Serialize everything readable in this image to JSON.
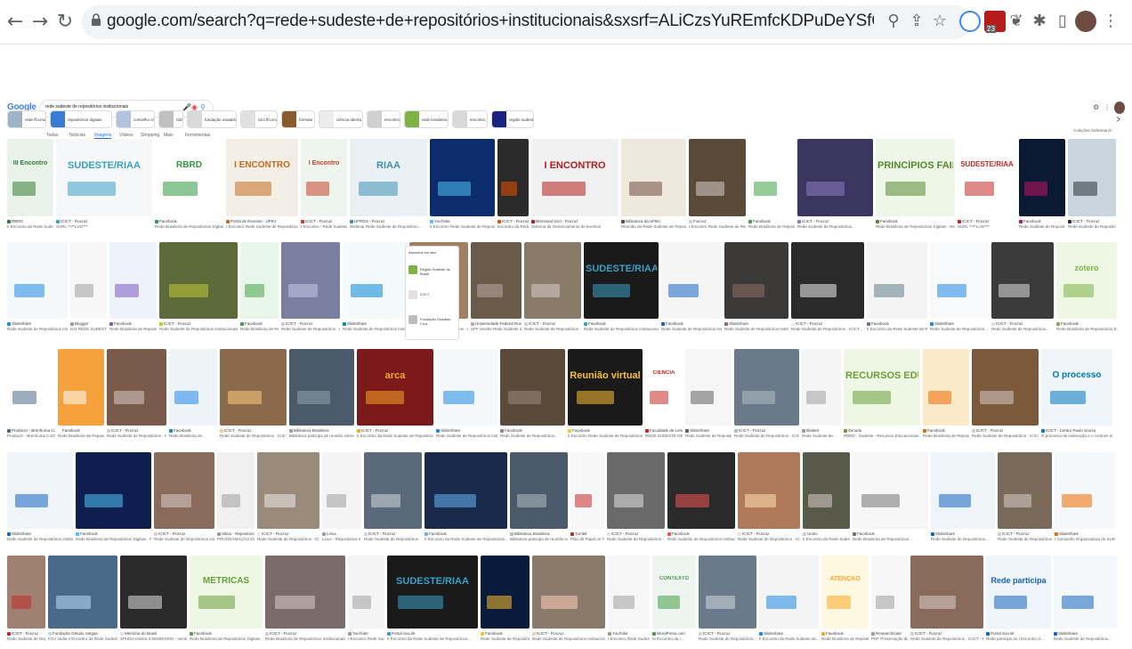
{
  "browser": {
    "url": "google.com/search?q=rede+sudeste+de+repositórios+institucionais&sxsrf=ALiCzsYuREmfcKDPuDeYSfCMs3Wp_0_ZYA:1672071993020&source=lnms&tbm=isch&sa=X...",
    "badge_count": "23",
    "nav_icons": [
      "back-arrow-icon",
      "forward-arrow-icon",
      "reload-icon"
    ]
  },
  "google": {
    "logo": "Google",
    "query": "rede sudeste de repositórios institucionais",
    "tabs": [
      "Todas",
      "Notícias",
      "Imagens",
      "Vídeos",
      "Shopping",
      "Mais",
      "Ferramentas"
    ],
    "right_links": "Coleções  SafeSearch"
  },
  "chips": [
    {
      "label": "rede ffccmus",
      "color": "#9fb3c8"
    },
    {
      "label": "repositórios digitais",
      "color": "#3a7bd5"
    },
    {
      "label": "conselho ciwt",
      "color": "#b0c4de"
    },
    {
      "label": "rbbt",
      "color": "#c0c0c0"
    },
    {
      "label": "fundação oswaldo",
      "color": "#d9d9d9"
    },
    {
      "label": "icict ffccmus",
      "color": "#e0e0e0"
    },
    {
      "label": "formato",
      "color": "#8b5a2b"
    },
    {
      "label": "ciência aberta",
      "color": "#ececec"
    },
    {
      "label": "encontro",
      "color": "#d0d0d0"
    },
    {
      "label": "rede brasileira",
      "color": "#7cb342"
    },
    {
      "label": "encontro",
      "color": "#d8d8d8"
    },
    {
      "label": "região sudeste",
      "color": "#1a237e"
    }
  ],
  "side_panel": {
    "title": "Assuntos em alta",
    "items": [
      "Região Sudeste do Brasil",
      "ICICT",
      "Fundação Oswaldo Cruz"
    ]
  },
  "rows": [
    [
      {
        "bg": "#eaf3ea",
        "accent": "#2e7d32",
        "text": "III Encontro",
        "src": "RBRD",
        "caption": "II Encontro da Rede Sudeste de R..."
      },
      {
        "bg": "#f5f7f9",
        "accent": "#3aa0c8",
        "text": "SUDESTE/RIAA",
        "src": "ICICT - Fiocruz",
        "caption": "SURL **7*LUG***"
      },
      {
        "bg": "#ffffff",
        "accent": "#2e9b3e",
        "text": "RBRD",
        "src": "Facebook",
        "caption": "Rede Brasileira de Repositórios Digitais - Fac..."
      },
      {
        "bg": "#f4efe6",
        "accent": "#c66a1e",
        "text": "I ENCONTRO",
        "src": "Portal de Eventos - UFRJ",
        "caption": "I Encontro Rede Sudeste de Repositórios..."
      },
      {
        "bg": "#eef4ee",
        "accent": "#c8402a",
        "text": "I Encontro",
        "src": "ICICT - Fiocruz",
        "caption": "I Encontro - Rede Sudeste de..."
      },
      {
        "bg": "#e9f1f4",
        "accent": "#3f8fb0",
        "text": "RIAA",
        "src": "UFRGS - Fiocruz",
        "caption": "Webinar Rede Sudeste de Repositório..."
      },
      {
        "bg": "#0d2c6c",
        "accent": "#4fc3f7",
        "text": "",
        "src": "YouTube",
        "caption": "II Encontro Rede Sudeste de Repositó..."
      },
      {
        "bg": "#2b2b2b",
        "accent": "#e65100",
        "text": "",
        "src": "ICICT - Fiocruz",
        "caption": "Encontro da Rede Sude..."
      },
      {
        "bg": "#f1f1f1",
        "accent": "#b71c1c",
        "text": "I ENCONTRO",
        "src": "Brennand Icict - Fiocruz",
        "caption": "Sistema de Gerenciamento de Eventos"
      },
      {
        "bg": "#efe9dd",
        "accent": "#6d4c41",
        "text": "",
        "src": "Biblioteca da UFBA",
        "caption": "Reunião da Rede Sudeste de Repositórios..."
      },
      {
        "bg": "#5a4a3a",
        "accent": "#d7ccc8",
        "text": "",
        "src": "Fiocruz",
        "caption": "I Encontro Rede Sudeste de Repositório..."
      },
      {
        "bg": "#ffffff",
        "accent": "#43a047",
        "text": "",
        "src": "Facebook",
        "caption": "Rede Brasileira de Repositórios Digitais..."
      },
      {
        "bg": "#3a3660",
        "accent": "#8e7cc3",
        "text": "",
        "src": "ICICT - Fiocruz",
        "caption": "Rede Sudeste de Repositórios..."
      },
      {
        "bg": "#eef6e8",
        "accent": "#558b2f",
        "text": "PRINCÍPIOS FAIR",
        "src": "Facebook",
        "caption": "Rede Brasileira de Repositórios Digitais - Rede Sudeste"
      },
      {
        "bg": "#ffffff",
        "accent": "#c62828",
        "text": "SUDESTE/RIAA",
        "src": "ICICT - Fiocruz",
        "caption": "SURL **7*LUG***"
      },
      {
        "bg": "#0a1a33",
        "accent": "#c51162",
        "text": "",
        "src": "Facebook",
        "caption": "Rede Sudeste de Reposit..."
      },
      {
        "bg": "#c9d4dc",
        "accent": "#263238",
        "text": "",
        "src": "ICICT - Fiocruz",
        "caption": "Rede Sudeste de Repositórios - ICICT..."
      }
    ],
    [
      {
        "bg": "#f4f8fb",
        "accent": "#1e88e5",
        "text": "",
        "src": "SlideShare",
        "caption": "Rede Sudeste de Repositórios Institucionais..."
      },
      {
        "bg": "#f7f7f7",
        "accent": "#9e9e9e",
        "text": "",
        "src": "Blogger",
        "caption": "DAI REDE SUDESTE DE..."
      },
      {
        "bg": "#eef2fb",
        "accent": "#7e57c2",
        "text": "",
        "src": "Facebook",
        "caption": "Rede Brasileira de Repositório..."
      },
      {
        "bg": "#5d6b3a",
        "accent": "#c0ca33",
        "text": "",
        "src": "ICICT - Fiocruz",
        "caption": "Rede Sudeste de Repositórios Institucionais..."
      },
      {
        "bg": "#e8f5e9",
        "accent": "#43a047",
        "text": "",
        "src": "Facebook",
        "caption": "Rede Brasileira de Rep..."
      },
      {
        "bg": "#7a7ea0",
        "accent": "#c5cae9",
        "text": "",
        "src": "ICICT - Fiocruz",
        "caption": "Rede Sudeste de Repositórios - ICICT..."
      },
      {
        "bg": "#f4f9fc",
        "accent": "#0288d1",
        "text": "",
        "src": "SlideShare",
        "caption": "Rede Sudeste de Repositórios Institucionais..."
      },
      {
        "bg": "#a08060",
        "accent": "#4e342e",
        "text": "",
        "src": "ICICT - Fiocruz",
        "caption": "Rede Sudeste de Repositórios - ICICT..."
      },
      {
        "bg": "#6a5a4a",
        "accent": "#bcaaa4",
        "text": "",
        "src": "Universidade Federal Rural...",
        "caption": "UFF recebe Rede Sudeste de..."
      },
      {
        "bg": "#8a7a6a",
        "accent": "#d7ccc8",
        "text": "",
        "src": "ICICT - Fiocruz",
        "caption": "Rede Sudeste de Repositórios - ICICT..."
      },
      {
        "bg": "#1a1a1a",
        "accent": "#3aa0c8",
        "text": "SUDESTE/RIAA",
        "src": "Facebook",
        "caption": "Rede Sudeste de Repositórios Institucionais..."
      },
      {
        "bg": "#f5f5f5",
        "accent": "#1565c0",
        "text": "",
        "src": "Facebook",
        "caption": "Rede Sudeste de Repositórios Institucionais..."
      },
      {
        "bg": "#3c3a38",
        "accent": "#8d6e63",
        "text": "",
        "src": "SlideShare",
        "caption": "Rede Sudeste de Repositórios Institucionais..."
      },
      {
        "bg": "#2a2a2a",
        "accent": "#eeeeee",
        "text": "",
        "src": "ICICT - Fiocruz",
        "caption": "Rede Sudeste de Repositórios - ICICT..."
      },
      {
        "bg": "#f4f4f4",
        "accent": "#607d8b",
        "text": "",
        "src": "Facebook",
        "caption": "II Encontro da Rede Sudeste de Repositórios..."
      },
      {
        "bg": "#f8f9fa",
        "accent": "#1e88e5",
        "text": "",
        "src": "SlideShare",
        "caption": "Rede Sudeste de Repositórios..."
      },
      {
        "bg": "#3b3b3b",
        "accent": "#e0e0e0",
        "text": "",
        "src": "ICICT - Fiocruz",
        "caption": "Rede Sudeste de Repositórios..."
      },
      {
        "bg": "#eef6e4",
        "accent": "#7cb342",
        "text": "zotero",
        "src": "Facebook",
        "caption": "Rede Brasileira de Repositórios Digitais - Rede Sude..."
      }
    ],
    [
      {
        "bg": "#ffffff",
        "accent": "#4a6a8a",
        "text": "",
        "src": "Producer - Brenhuma Conh...",
        "caption": "Producer - Brenhuma Conhecim..."
      },
      {
        "bg": "#f6a13b",
        "accent": "#ffffff",
        "text": "",
        "src": "Facebook",
        "caption": "Rede Brasileira de Repositório..."
      },
      {
        "bg": "#7a5a4a",
        "accent": "#d7ccc8",
        "text": "",
        "src": "ICICT - Fiocruz",
        "caption": "Rede Sudeste de Repositórios - ICICT..."
      },
      {
        "bg": "#eef3fa",
        "accent": "#1e88e5",
        "text": "",
        "src": "Facebook",
        "caption": "Rede Brasileira de..."
      },
      {
        "bg": "#8a6a4a",
        "accent": "#ffcc80",
        "text": "",
        "src": "ICICT - Fiocruz",
        "caption": "Rede Sudeste de Repositórios - ICICT - Fiocruz"
      },
      {
        "bg": "#4a5a6a",
        "accent": "#90a4ae",
        "text": "",
        "src": "Biblioteca Brasileira",
        "caption": "Biblioteca participa de reunião sobre repositórios..."
      },
      {
        "bg": "#7a1a1a",
        "accent": "#f9a825",
        "text": "arca",
        "src": "ICICT - Fiocruz",
        "caption": "II Encontro da Rede Sudeste de Repositórios Institucionais..."
      },
      {
        "bg": "#f4f8fb",
        "accent": "#1e88e5",
        "text": "",
        "src": "SlideShare",
        "caption": "Rede Sudeste de Repositórios Institucionais..."
      },
      {
        "bg": "#5a4a3a",
        "accent": "#a1887f",
        "text": "",
        "src": "Facebook",
        "caption": "Rede Sudeste de Repositórios..."
      },
      {
        "bg": "#1a1a1a",
        "accent": "#fbc02d",
        "text": "Reunião virtual",
        "src": "Facebook",
        "caption": "II Encontro Rede Sudeste de Repositórios - Fiocruz"
      },
      {
        "bg": "#ffffff",
        "accent": "#c62828",
        "text": "CIÊNCIA",
        "src": "Faculdade de Letras...",
        "caption": "REDE SUDESTE DE REP..."
      },
      {
        "bg": "#f6f6f6",
        "accent": "#616161",
        "text": "",
        "src": "SlideShare",
        "caption": "Rede Sudeste de Repositórios..."
      },
      {
        "bg": "#6a7a8a",
        "accent": "#b0bec5",
        "text": "",
        "src": "ICICT - Fiocruz",
        "caption": "Rede Sudeste de Repositórios - ICICT..."
      },
      {
        "bg": "#f5f5f5",
        "accent": "#9e9e9e",
        "text": "",
        "src": "Dialnet",
        "caption": "Rede Sudeste de..."
      },
      {
        "bg": "#eef6e4",
        "accent": "#689f38",
        "text": "RECURSOS EDUCACIONAIS",
        "src": "Zenodo",
        "caption": "RBRD - Sudeste - Recursos Educacionais Abertos em..."
      },
      {
        "bg": "#fbe9c8",
        "accent": "#ef6c00",
        "text": "",
        "src": "Facebook",
        "caption": "Rede Brasileira de Repositórios..."
      },
      {
        "bg": "#7a5a3a",
        "accent": "#d7ccc8",
        "text": "",
        "src": "ICICT - Fiocruz",
        "caption": "Rede Sudeste de Repositórios - ICICT..."
      },
      {
        "bg": "#eef6fb",
        "accent": "#0277bd",
        "text": "O processo",
        "src": "ICICT - Centro Paulo Souza",
        "caption": "O processo de indexação e o controle de vocabulário..."
      }
    ],
    [
      {
        "bg": "#eef4fa",
        "accent": "#1565c0",
        "text": "",
        "src": "SlideShare",
        "caption": "Rede Sudeste de Repositórios Institucionais..."
      },
      {
        "bg": "#0e1e4e",
        "accent": "#4fc3f7",
        "text": "",
        "src": "Facebook",
        "caption": "Rede Brasileira de Repositórios Digitais - Rede Sud..."
      },
      {
        "bg": "#8a6a5a",
        "accent": "#d7ccc8",
        "text": "",
        "src": "ICICT - Fiocruz",
        "caption": "Rede Sudeste de Repositórios Institucionais..."
      },
      {
        "bg": "#f0f0f0",
        "accent": "#9e9e9e",
        "text": "",
        "src": "Sibus - Repositório I...",
        "caption": "PROGRAMAÇÃO DO I..."
      },
      {
        "bg": "#9a8a7a",
        "accent": "#efebe9",
        "text": "",
        "src": "ICICT - Fiocruz",
        "caption": "Rede Sudeste de Repositórios - ICICT..."
      },
      {
        "bg": "#f4f4f4",
        "accent": "#9e9e9e",
        "text": "",
        "src": "Linux",
        "caption": "Linux - Repositórios Institucionais..."
      },
      {
        "bg": "#5a6a7a",
        "accent": "#cfd8dc",
        "text": "",
        "src": "ICICT - Fiocruz",
        "caption": "Rede Sudeste de Repositórios - ICICT..."
      },
      {
        "bg": "#1a2a4a",
        "accent": "#64b5f6",
        "text": "",
        "src": "Facebook",
        "caption": "II Encontro da Rede Sudeste de Repositórios..."
      },
      {
        "bg": "#4a5a6a",
        "accent": "#b0bec5",
        "text": "",
        "src": "Biblioteca Brasileira",
        "caption": "Biblioteca participa de reunião sobre repositórios..."
      },
      {
        "bg": "#f7f7f7",
        "accent": "#c62828",
        "text": "",
        "src": "Tumblr",
        "caption": "Plan de Papel on Tumblr..."
      },
      {
        "bg": "#6a6a6a",
        "accent": "#e0e0e0",
        "text": "",
        "src": "ICICT - Fiocruz",
        "caption": "Rede Sudeste de Repositórios - ICICT..."
      },
      {
        "bg": "#2a2a2a",
        "accent": "#ef5350",
        "text": "",
        "src": "Facebook",
        "caption": "Rede Sudeste de Repositórios Institucionais..."
      },
      {
        "bg": "#b07a5a",
        "accent": "#ffe0b2",
        "text": "",
        "src": "ICICT - Fiocruz",
        "caption": "Rede Sudeste de Repositórios - ICICT..."
      },
      {
        "bg": "#5a5a4a",
        "accent": "#d7ccc8",
        "text": "",
        "src": "Unirio",
        "caption": "II Encontro da Rede Sudeste..."
      },
      {
        "bg": "#f6f6f6",
        "accent": "#757575",
        "text": "",
        "src": "Facebook",
        "caption": "Rede Brasileira de Repositórios..."
      },
      {
        "bg": "#eef4fa",
        "accent": "#1565c0",
        "text": "",
        "src": "SlideShare",
        "caption": "Rede Sudeste de Repositórios..."
      },
      {
        "bg": "#7a6a5a",
        "accent": "#d7ccc8",
        "text": "",
        "src": "ICICT - Fiocruz",
        "caption": "Rede Sudeste de Repositórios..."
      },
      {
        "bg": "#f4f8fb",
        "accent": "#ef6c00",
        "text": "",
        "src": "SlideShare",
        "caption": "I Comissão Organizadora do SUDESTE/RI..."
      }
    ],
    [
      {
        "bg": "#a08070",
        "accent": "#c62828",
        "text": "",
        "src": "ICICT - Fiocruz",
        "caption": "Rede Sudeste de Repositórios..."
      },
      {
        "bg": "#4a6a8a",
        "accent": "#bbdefb",
        "text": "",
        "src": "Fundação Getulio Vargas",
        "caption": "FGV sedia II Encontro da Rede Sudeste de Reposit..."
      },
      {
        "bg": "#2a2a2a",
        "accent": "#e0e0e0",
        "text": "",
        "src": "Memória do Brasil",
        "caption": "SPHDH realiza II SEMINÁRIO - seminário sobre..."
      },
      {
        "bg": "#eef6e4",
        "accent": "#689f38",
        "text": "MÉTRICAS",
        "src": "Facebook",
        "caption": "Rede Brasileira de Repositórios Digitais - Rede Sudeste"
      },
      {
        "bg": "#7a6a6a",
        "accent": "#d7ccc8",
        "text": "",
        "src": "ICICT - Fiocruz",
        "caption": "Rede Brasileira de Repositórios Institucionais..."
      },
      {
        "bg": "#f4f4f4",
        "accent": "#9e9e9e",
        "text": "",
        "src": "YouTube",
        "caption": "I Encontro Rede Sudeste..."
      },
      {
        "bg": "#1a1a1a",
        "accent": "#3aa0c8",
        "text": "SUDESTE/RIAA",
        "src": "Portal Sou Br",
        "caption": "II Encontro da Rede Sudeste de Repositórios..."
      },
      {
        "bg": "#0a1a3a",
        "accent": "#fbc02d",
        "text": "",
        "src": "Facebook",
        "caption": "Rede Sudeste de Repositórios..."
      },
      {
        "bg": "#8a7a6a",
        "accent": "#ffccbc",
        "text": "",
        "src": "ICICT - Fiocruz",
        "caption": "Rede Sudeste de Repositórios Institucionais..."
      },
      {
        "bg": "#f6f6f6",
        "accent": "#9e9e9e",
        "text": "",
        "src": "YouTube",
        "caption": "I Encontro Rede Sudeste..."
      },
      {
        "bg": "#eef4f0",
        "accent": "#43a047",
        "text": "CONTEXTO",
        "src": "WordPress.com",
        "caption": "III Encontro da I..."
      },
      {
        "bg": "#6a7a8a",
        "accent": "#cfd8dc",
        "text": "",
        "src": "ICICT - Fiocruz",
        "caption": "Rede Sudeste de Repositórios..."
      },
      {
        "bg": "#f4f4f4",
        "accent": "#1e88e5",
        "text": "",
        "src": "SlideShare",
        "caption": "II Encontro da Rede Sudeste de..."
      },
      {
        "bg": "#fff8e1",
        "accent": "#f9a825",
        "text": "ATENÇÃO",
        "src": "Facebook",
        "caption": "Rede Brasileira de Repositório..."
      },
      {
        "bg": "#f7f7f7",
        "accent": "#9e9e9e",
        "text": "",
        "src": "ResearchGate",
        "caption": "PDF Preservação digit..."
      },
      {
        "bg": "#8a6a5a",
        "accent": "#d7ccc8",
        "text": "",
        "src": "ICICT - Fiocruz",
        "caption": "Rede Sudeste de Repositórios - ICICT - Fiocruz"
      },
      {
        "bg": "#eef4fa",
        "accent": "#1565c0",
        "text": "Rede participa",
        "src": "Portal Sou Br",
        "caption": "Rede participa do I Encontro d..."
      },
      {
        "bg": "#f4f8fb",
        "accent": "#1565c0",
        "text": "",
        "src": "SlideShare",
        "caption": "Rede Sudeste de Repositórios..."
      }
    ]
  ]
}
